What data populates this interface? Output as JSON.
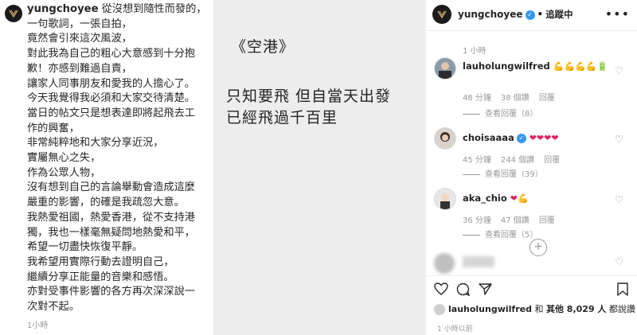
{
  "left": {
    "username": "yungchoyee",
    "caption_lines": [
      "從沒想到隨性而發的，",
      "一句歌詞，一張自拍，",
      "竟然會引來這次風波，",
      "對此我為自己的粗心大意感到十分抱",
      "歉！亦感到難過自責，",
      "讓家人同事朋友和愛我的人擔心了。",
      "今天我覺得我必須和大家交待清楚。",
      "當日的帖文只是想表達即將起飛去工",
      "作的興奮，",
      "非常純粹地和大家分享近況，",
      "實屬無心之失，",
      "作為公眾人物，",
      "沒有想到自己的言論舉動會造成這麼",
      "嚴重的影響，的確是我疏忽大意。",
      "我熱愛祖國，熱愛香港，從不支持港",
      "獨，我也一樣毫無疑問地熱愛和平，",
      "希望一切盡快恢復平靜。",
      "我希望用實際行動去證明自己，",
      "繼續分享正能量的音樂和感悟。",
      "亦對受事件影響的各方再次深深說一",
      "次對不起。"
    ],
    "time": "1小時"
  },
  "center": {
    "title": "《空港》",
    "line1": "只知要飛 但自當天出發",
    "line2": "已經飛過千百里"
  },
  "right": {
    "header": {
      "username": "yungchoyee",
      "follow": "追蹤中",
      "more": "•••"
    },
    "top_time": "1 小時",
    "comments": [
      {
        "user": "lauholungwilfred",
        "emoji": "💪💪💪💪🔋",
        "time": "48 分鐘",
        "likes": "38 個讚",
        "reply": "回覆",
        "replies": "查看回覆（8）"
      },
      {
        "user": "choisaaaa",
        "emoji": "❤❤❤❤",
        "time": "45 分鐘",
        "likes": "244 個讚",
        "reply": "回覆",
        "replies": "查看回覆（39）"
      },
      {
        "user": "aka_chio",
        "emoji": "❤💪",
        "time": "36 分鐘",
        "likes": "47 個讚",
        "reply": "回覆",
        "replies": "查看回覆（5）"
      }
    ],
    "likes_line": {
      "user": "lauholungwilfred",
      "rest_prefix": " 和 ",
      "others": "其他 8,029 人",
      "rest_suffix": " 都說讚"
    },
    "bottom_time": "1 小時以前"
  }
}
